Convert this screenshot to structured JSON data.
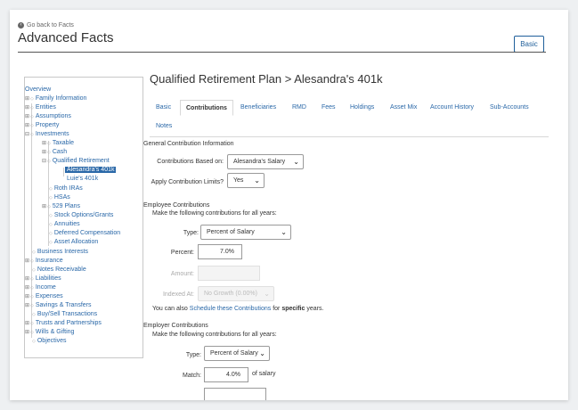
{
  "header": {
    "back_link": "Go back to Facts",
    "title": "Advanced Facts",
    "basic_button": "Basic"
  },
  "tree": {
    "overview": "Overview",
    "family_information": "Family Information",
    "entities": "Entities",
    "assumptions": "Assumptions",
    "property": "Property",
    "investments": "Investments",
    "taxable": "Taxable",
    "cash": "Cash",
    "qualified_retirement": "Qualified Retirement",
    "alesandras_401k": "Alesandra's 401k",
    "luies_401k": "Luie's 401k",
    "roth_iras": "Roth IRAs",
    "hsas": "HSAs",
    "plans_529": "529 Plans",
    "stock_options": "Stock Options/Grants",
    "annuities": "Annuities",
    "deferred_comp": "Deferred Compensation",
    "asset_allocation": "Asset Allocation",
    "business_interests": "Business Interests",
    "insurance": "Insurance",
    "notes_receivable": "Notes Receivable",
    "liabilities": "Liabilities",
    "income": "Income",
    "expenses": "Expenses",
    "savings_transfers": "Savings & Transfers",
    "buy_sell": "Buy/Sell Transactions",
    "trusts": "Trusts and Partnerships",
    "wills": "Wills & Gifting",
    "objectives": "Objectives"
  },
  "main": {
    "title": "Qualified Retirement Plan > Alesandra's 401k",
    "tabs": {
      "basic": "Basic",
      "contributions": "Contributions",
      "beneficiaries": "Beneficiaries",
      "rmd": "RMD",
      "fees": "Fees",
      "holdings": "Holdings",
      "asset_mix": "Asset Mix",
      "account_history": "Account History",
      "sub_accounts": "Sub-Accounts",
      "notes": "Notes"
    },
    "general": {
      "heading": "General Contribution Information",
      "based_on_label": "Contributions Based on:",
      "based_on_value": "Alesandra's Salary",
      "limits_label": "Apply Contribution Limits?",
      "limits_value": "Yes"
    },
    "employee": {
      "heading": "Employee Contributions",
      "subheading": "Make the following contributions for all years:",
      "type_label": "Type:",
      "type_value": "Percent of Salary",
      "percent_label": "Percent:",
      "percent_value": "7.0%",
      "amount_label": "Amount:",
      "amount_value": "",
      "indexed_label": "Indexed At:",
      "indexed_value": "No Growth (0.00%)",
      "schedule_prefix": "You can also",
      "schedule_link": "Schedule these Contributions",
      "schedule_mid": "for",
      "schedule_bold": "specific",
      "schedule_suffix": "years."
    },
    "employer": {
      "heading": "Employer Contributions",
      "subheading": "Make the following contributions for all years:",
      "type_label": "Type:",
      "type_value": "Percent of Salary",
      "match_label": "Match:",
      "match_value": "4.0%",
      "match_suffix": "of salary"
    }
  }
}
